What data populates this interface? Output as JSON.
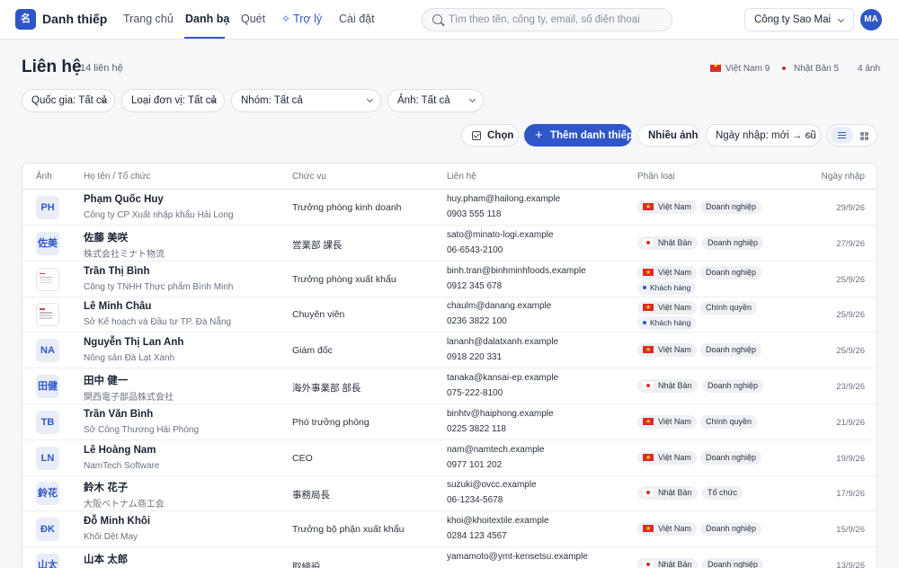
{
  "app": {
    "logo": "名",
    "title": "Danh thiếp",
    "nav": [
      {
        "label": "Trang chủ"
      },
      {
        "label": "Danh bạ"
      },
      {
        "label": "Quét"
      },
      {
        "label": "Trợ lý"
      },
      {
        "label": "Cài đặt"
      }
    ],
    "active_nav": "Danh bạ",
    "search_placeholder": "Tìm theo tên, công ty, email, số điện thoại",
    "company": "Công ty Sao Mai",
    "user_initials": "MA",
    "accent_color": "#2f56c7"
  },
  "header": {
    "title": "Liên hệ",
    "count": "14 liên hệ",
    "stat_vn": "Việt Nam 9",
    "stat_jp": "Nhật Bản 5",
    "stat_images": "4 ảnh"
  },
  "filters": [
    {
      "label": "Quốc gia: Tất cả"
    },
    {
      "label": "Loại đơn vị: Tất cả"
    },
    {
      "label": "Nhóm: Tất cả"
    },
    {
      "label": "Ảnh: Tất cả"
    }
  ],
  "actions": {
    "select": "Chọn",
    "add": "Thêm danh thiếp",
    "multi": "Nhiều ảnh",
    "sort": "Ngày nhập: mới → cũ"
  },
  "table": {
    "columns": [
      "Ảnh",
      "Họ tên / Tổ chức",
      "Chức vụ",
      "Liên hệ",
      "Phân loại",
      "Ngày nhập"
    ],
    "rows": [
      {
        "thumb": "PH",
        "name": "Phạm Quốc Huy",
        "org": "Công ty CP Xuất nhập khẩu Hải Long",
        "title": "Trưởng phòng kinh doanh",
        "email": "huy.pham@hailong.example",
        "phone": "0903 555 118",
        "country": "Việt Nam",
        "flag": "vn",
        "type": "Doanh nghiệp",
        "tag": "",
        "date": "29/9/26"
      },
      {
        "thumb": "佐美",
        "name": "佐藤 美咲",
        "org": "株式会社ミナト物流",
        "title": "営業部 課長",
        "email": "sato@minato-logi.example",
        "phone": "06-6543-2100",
        "country": "Nhật Bản",
        "flag": "jp",
        "type": "Doanh nghiệp",
        "tag": "",
        "date": "27/9/26"
      },
      {
        "thumb": "",
        "name": "Trần Thị Bình",
        "org": "Công ty TNHH Thực phẩm Bình Minh",
        "title": "Trưởng phòng xuất khẩu",
        "email": "binh.tran@binhminhfoods.example",
        "phone": "0912 345 678",
        "country": "Việt Nam",
        "flag": "vn",
        "type": "Doanh nghiệp",
        "tag": "Khách hàng",
        "date": "25/9/26"
      },
      {
        "thumb": "",
        "name": "Lê Minh Châu",
        "org": "Sở Kế hoạch và Đầu tư TP. Đà Nẵng",
        "title": "Chuyên viên",
        "email": "chaulm@danang.example",
        "phone": "0236 3822 100",
        "country": "Việt Nam",
        "flag": "vn",
        "type": "Chính quyền",
        "tag": "Khách hàng",
        "date": "25/9/26"
      },
      {
        "thumb": "NA",
        "name": "Nguyễn Thị Lan Anh",
        "org": "Nông sản Đà Lạt Xanh",
        "title": "Giám đốc",
        "email": "lananh@dalatxanh.example",
        "phone": "0918 220 331",
        "country": "Việt Nam",
        "flag": "vn",
        "type": "Doanh nghiệp",
        "tag": "",
        "date": "25/9/26"
      },
      {
        "thumb": "田健",
        "name": "田中 健一",
        "org": "関西電子部品株式会社",
        "title": "海外事業部 部長",
        "email": "tanaka@kansai-ep.example",
        "phone": "075-222-8100",
        "country": "Nhật Bản",
        "flag": "jp",
        "type": "Doanh nghiệp",
        "tag": "",
        "date": "23/9/26"
      },
      {
        "thumb": "TB",
        "name": "Trần Văn Bình",
        "org": "Sở Công Thương Hải Phòng",
        "title": "Phó trưởng phòng",
        "email": "binhtv@haiphong.example",
        "phone": "0225 3822 118",
        "country": "Việt Nam",
        "flag": "vn",
        "type": "Chính quyền",
        "tag": "",
        "date": "21/9/26"
      },
      {
        "thumb": "LN",
        "name": "Lê Hoàng Nam",
        "org": "NamTech Software",
        "title": "CEO",
        "email": "nam@namtech.example",
        "phone": "0977 101 202",
        "country": "Việt Nam",
        "flag": "vn",
        "type": "Doanh nghiệp",
        "tag": "",
        "date": "19/9/26"
      },
      {
        "thumb": "鈴花",
        "name": "鈴木 花子",
        "org": "大阪ベトナム商工会",
        "title": "事務局長",
        "email": "suzuki@ovcc.example",
        "phone": "06-1234-5678",
        "country": "Nhật Bản",
        "flag": "jp",
        "type": "Tổ chức",
        "tag": "",
        "date": "17/9/26"
      },
      {
        "thumb": "ĐK",
        "name": "Đỗ Minh Khôi",
        "org": "Khôi Dệt May",
        "title": "Trưởng bộ phận xuất khẩu",
        "email": "khoi@khoitextile.example",
        "phone": "0284 123 4567",
        "country": "Việt Nam",
        "flag": "vn",
        "type": "Doanh nghiệp",
        "tag": "",
        "date": "15/9/26"
      },
      {
        "thumb": "山太",
        "name": "山本 太郎",
        "org": "",
        "title": "取締役",
        "email": "yamamoto@ymt-kensetsu.example",
        "phone": "",
        "country": "Nhật Bản",
        "flag": "jp",
        "type": "Doanh nghiệp",
        "tag": "",
        "date": "13/9/26"
      }
    ]
  }
}
